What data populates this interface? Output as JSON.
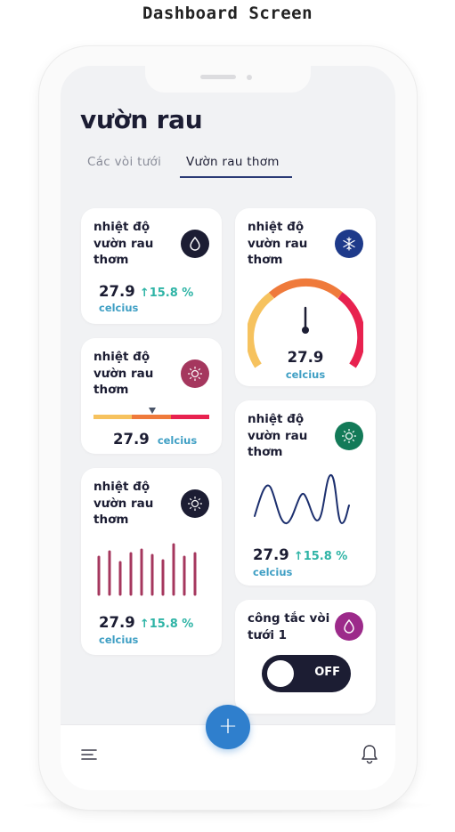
{
  "caption": "Dashboard Screen",
  "page_title": "vườn rau",
  "tabs": [
    {
      "label": "Các vòi tưới",
      "active": false
    },
    {
      "label": "Vườn rau thơm",
      "active": true
    }
  ],
  "cards": {
    "left1": {
      "title": "nhiệt độ vườn rau thơm",
      "icon": "water-drop-icon",
      "value": "27.9",
      "delta": "↑15.8 %",
      "unit": "celcius",
      "icon_bg": "#1c1d33"
    },
    "left2": {
      "title": "nhiệt độ vườn rau thơm",
      "icon": "sun-icon",
      "value": "27.9",
      "unit": "celcius",
      "icon_bg": "#a5375e",
      "scale_colors": [
        "#f6c25e",
        "#ef7a3b",
        "#e8224f"
      ]
    },
    "left3": {
      "title": "nhiệt độ vườn rau thơm",
      "icon": "sun-icon",
      "value": "27.9",
      "delta": "↑15.8 %",
      "unit": "celcius",
      "icon_bg": "#1c1d33",
      "bar_color": "#a5375e"
    },
    "right1": {
      "title": "nhiệt độ vườn rau thơm",
      "icon": "snowflake-icon",
      "value": "27.9",
      "unit": "celcius",
      "icon_bg": "#1e3a8a"
    },
    "right2": {
      "title": "nhiệt độ vườn rau thơm",
      "icon": "sun-icon",
      "value": "27.9",
      "delta": "↑15.8 %",
      "unit": "celcius",
      "icon_bg": "#137a58"
    },
    "right3": {
      "title": "công tắc vòi tưới 1",
      "icon": "water-drop-icon",
      "icon_bg": "#9c2a8a",
      "switch_label": "OFF",
      "switch_on": false
    }
  },
  "nav": {
    "menu_icon": "menu-icon",
    "fab_label": "+",
    "bell_icon": "bell-icon"
  },
  "colors": {
    "accent": "#2f7fcd",
    "dark": "#1c1d33",
    "teal": "#2fb4a6",
    "unit_blue": "#3f9fc4"
  }
}
